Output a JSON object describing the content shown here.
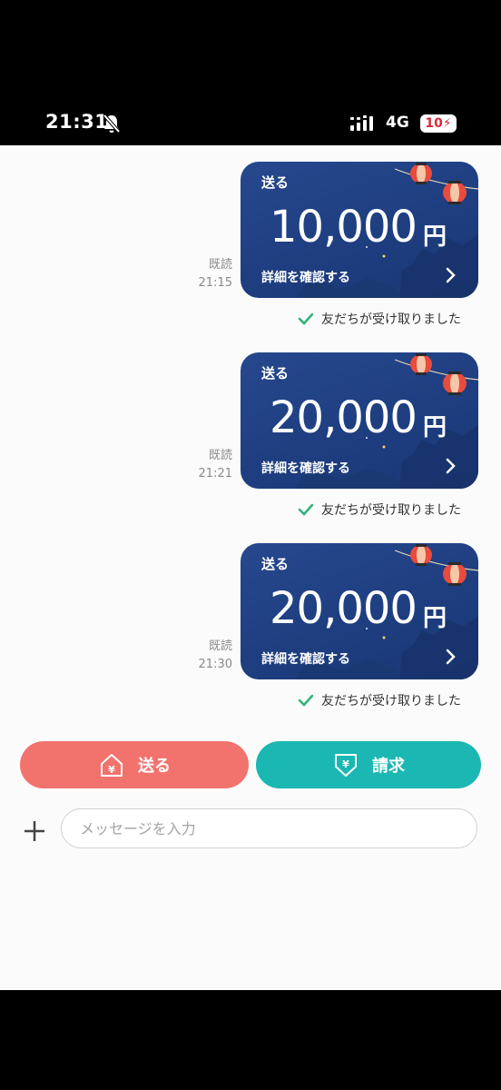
{
  "status_bar": {
    "time": "21:31",
    "network": "4G",
    "battery": "10",
    "icons": [
      "bell-slash-icon",
      "signal-icon",
      "charging-bolt-icon"
    ]
  },
  "messages": [
    {
      "read_label": "既読",
      "time": "21:15",
      "label": "送る",
      "amount": "10,000",
      "currency": "円",
      "details_label": "詳細を確認する",
      "status": "友だちが受け取りました"
    },
    {
      "read_label": "既読",
      "time": "21:21",
      "label": "送る",
      "amount": "20,000",
      "currency": "円",
      "details_label": "詳細を確認する",
      "status": "友だちが受け取りました"
    },
    {
      "read_label": "既読",
      "time": "21:30",
      "label": "送る",
      "amount": "20,000",
      "currency": "円",
      "details_label": "詳細を確認する",
      "status": "友だちが受け取りました"
    }
  ],
  "actions": {
    "send_label": "送る",
    "request_label": "請求",
    "send_color": "#f2726d",
    "request_color": "#1bb7b3"
  },
  "composer": {
    "placeholder": "メッセージを入力"
  },
  "colors": {
    "card_bg": "#1e3e80",
    "check": "#2fb37a"
  }
}
